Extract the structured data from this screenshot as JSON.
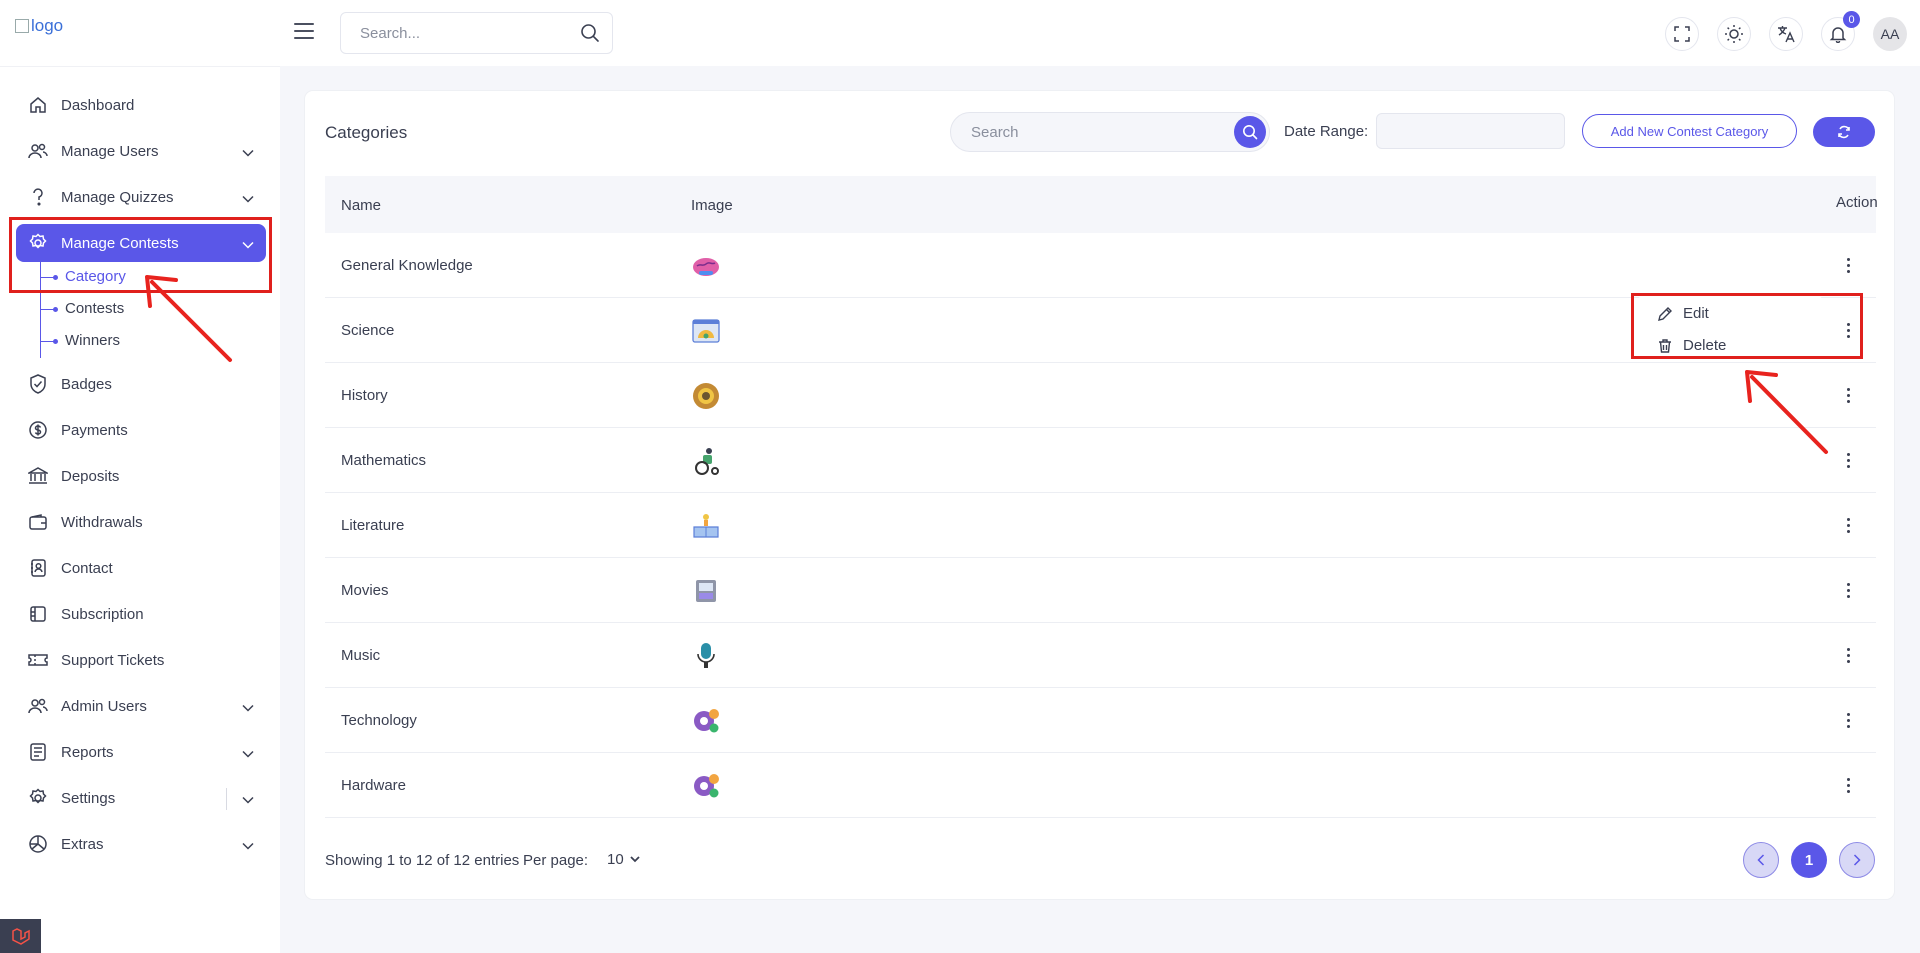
{
  "header": {
    "logo_alt": "logo",
    "search_placeholder": "Search...",
    "notification_count": "0",
    "avatar_initials": "AA"
  },
  "sidebar": {
    "items": [
      {
        "label": "Dashboard",
        "icon": "home-icon"
      },
      {
        "label": "Manage Users",
        "icon": "users-icon"
      },
      {
        "label": "Manage Quizzes",
        "icon": "question-icon"
      },
      {
        "label": "Manage Contests",
        "icon": "gear-badge-icon"
      },
      {
        "label": "Badges",
        "icon": "shield-check-icon"
      },
      {
        "label": "Payments",
        "icon": "dollar-icon"
      },
      {
        "label": "Deposits",
        "icon": "bank-icon"
      },
      {
        "label": "Withdrawals",
        "icon": "wallet-icon"
      },
      {
        "label": "Contact",
        "icon": "contact-book-icon"
      },
      {
        "label": "Subscription",
        "icon": "subscription-icon"
      },
      {
        "label": "Support Tickets",
        "icon": "ticket-icon"
      },
      {
        "label": "Admin Users",
        "icon": "admin-users-icon"
      },
      {
        "label": "Reports",
        "icon": "reports-icon"
      },
      {
        "label": "Settings",
        "icon": "settings-icon"
      },
      {
        "label": "Extras",
        "icon": "extras-icon"
      }
    ],
    "contest_sub": [
      "Category",
      "Contests",
      "Winners"
    ]
  },
  "main": {
    "title": "Categories",
    "search_placeholder": "Search",
    "date_range_label": "Date Range:",
    "add_button": "Add New Contest Category",
    "columns": {
      "name": "Name",
      "image": "Image",
      "action": "Action"
    },
    "rows": [
      {
        "name": "General Knowledge",
        "icon": "brain-icon"
      },
      {
        "name": "Science",
        "icon": "science-screen-icon"
      },
      {
        "name": "History",
        "icon": "history-coin-icon"
      },
      {
        "name": "Mathematics",
        "icon": "wheelchair-icon"
      },
      {
        "name": "Literature",
        "icon": "book-lamp-icon"
      },
      {
        "name": "Movies",
        "icon": "film-icon"
      },
      {
        "name": "Music",
        "icon": "microphone-icon"
      },
      {
        "name": "Technology",
        "icon": "gear-tech-icon"
      },
      {
        "name": "Hardware",
        "icon": "gear-hardware-icon"
      }
    ],
    "footer": {
      "showing": "Showing 1 to 12 of 12 entries",
      "per_page_label": "Per page:",
      "per_page_value": "10",
      "current_page": "1"
    },
    "row_menu": {
      "edit": "Edit",
      "delete": "Delete"
    }
  },
  "colors": {
    "accent": "#5a57e8",
    "annotation": "#e0201d"
  }
}
